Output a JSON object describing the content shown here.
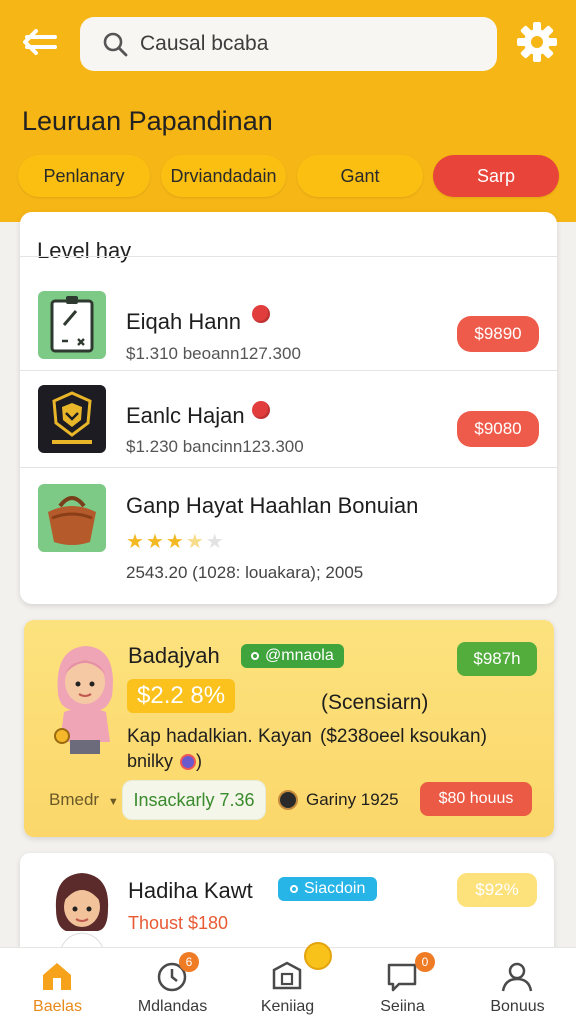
{
  "app": {
    "search_text": "Causal bcaba",
    "page_title": "Leuruan Papandinan",
    "accent": "#f6b616",
    "active_color": "#e8443a"
  },
  "chips": [
    {
      "label": "Penlanary",
      "active": false
    },
    {
      "label": "Drviandadain",
      "active": false
    },
    {
      "label": "Gant",
      "active": false
    },
    {
      "label": "Sarp",
      "active": true
    }
  ],
  "level_list": {
    "title": "Level hay",
    "items": [
      {
        "name": "Eiqah Hann",
        "sub": "$1.310 beoann127.300",
        "price": "$9890",
        "icon": "tablet-icon"
      },
      {
        "name": "Eanlc Hajan",
        "sub": "$1.230 bancinn123.300",
        "price": "$9080",
        "icon": "shield-badge-icon"
      },
      {
        "name": "Ganp Hayat Haahlan Bonuian",
        "sub": "2543.20 (1028: louakara); 2005",
        "rating": 3.5,
        "rating_max": 5,
        "icon": "bag-icon"
      }
    ]
  },
  "featured": {
    "name": "Badajyah",
    "tag": "@mnaola",
    "price_pill": "$987h",
    "amount": "$2.2 8%",
    "screen": "(Scensiarn)",
    "line1a": "Kap hadalkian. Kayan",
    "line1b": "($238oeel ksoukan)",
    "line2": "bnilky",
    "dropdown": "Bmedr",
    "badge": "Insackarly 7.36",
    "coin_text": "Gariny 1925",
    "bonus": "$80 houus"
  },
  "second": {
    "name": "Hadiha Kawt",
    "tag": "Siacdoin",
    "pill": "$92%",
    "sub": "Thoust $180"
  },
  "nav": [
    {
      "label": "Baelas",
      "icon": "home-icon",
      "active": true,
      "badge": ""
    },
    {
      "label": "Mdlandas",
      "icon": "clock-icon",
      "active": false,
      "badge": "6"
    },
    {
      "label": "Keniiag",
      "icon": "box-icon",
      "active": false,
      "badge": ""
    },
    {
      "label": "Seiina",
      "icon": "chat-icon",
      "active": false,
      "badge": "0"
    },
    {
      "label": "Bonuus",
      "icon": "user-icon",
      "active": false,
      "badge": ""
    }
  ]
}
